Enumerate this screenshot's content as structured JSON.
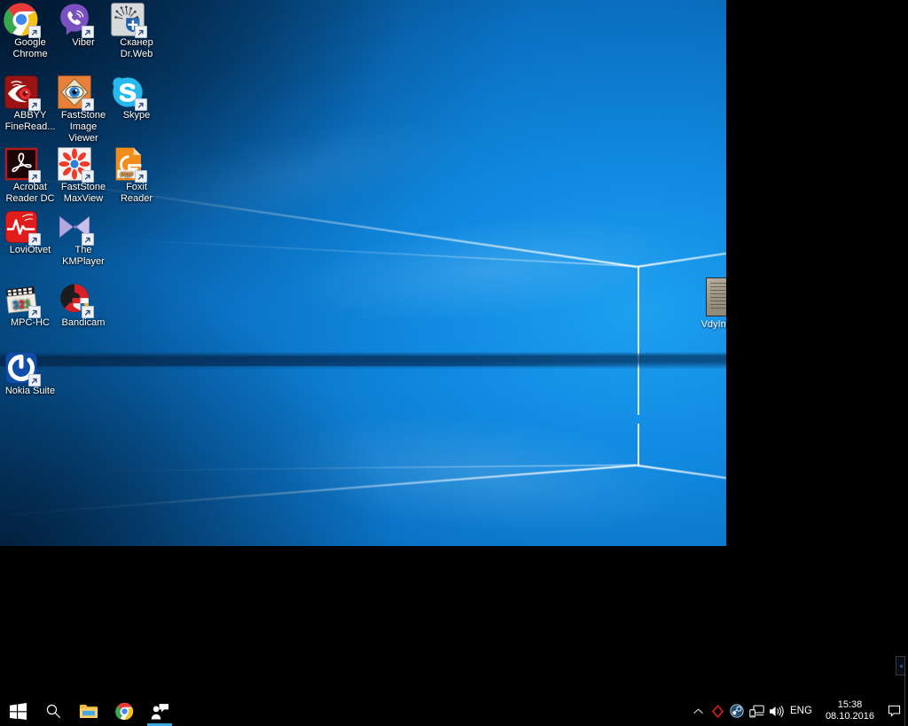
{
  "desktop": {
    "wallpaper_name": "windows-10-hero-wallpaper",
    "icons": [
      {
        "id": "google-chrome",
        "label": "Google Chrome",
        "icon": "chrome-icon",
        "col": 0,
        "row": 0
      },
      {
        "id": "viber",
        "label": "Viber",
        "icon": "viber-icon",
        "col": 1,
        "row": 0
      },
      {
        "id": "skaner-drweb",
        "label": "Сканер Dr.Web",
        "icon": "drweb-scanner-icon",
        "col": 2,
        "row": 0
      },
      {
        "id": "abbyy-finereader",
        "label": "ABBYY FineRead...",
        "icon": "abbyy-finereader-icon",
        "col": 0,
        "row": 1
      },
      {
        "id": "faststone-image-viewer",
        "label": "FastStone Image Viewer",
        "icon": "faststone-viewer-icon",
        "col": 1,
        "row": 1
      },
      {
        "id": "skype",
        "label": "Skype",
        "icon": "skype-icon",
        "col": 2,
        "row": 1
      },
      {
        "id": "acrobat-reader-dc",
        "label": "Acrobat Reader DC",
        "icon": "acrobat-reader-icon",
        "col": 0,
        "row": 2
      },
      {
        "id": "faststone-maxview",
        "label": "FastStone MaxView",
        "icon": "faststone-maxview-icon",
        "col": 1,
        "row": 2
      },
      {
        "id": "foxit-reader",
        "label": "Foxit Reader",
        "icon": "foxit-reader-icon",
        "col": 2,
        "row": 2
      },
      {
        "id": "loviotvet",
        "label": "LoviOtvet",
        "icon": "loviotvet-icon",
        "col": 0,
        "row": 3
      },
      {
        "id": "the-kmplayer",
        "label": "The KMPlayer",
        "icon": "kmplayer-icon",
        "col": 1,
        "row": 3
      },
      {
        "id": "mpc-hc",
        "label": "MPC-HC",
        "icon": "mpc-hc-icon",
        "col": 0,
        "row": 4
      },
      {
        "id": "bandicam",
        "label": "Bandicam",
        "icon": "bandicam-icon",
        "col": 1,
        "row": 4
      },
      {
        "id": "nokia-suite",
        "label": "Nokia Suite",
        "icon": "nokia-suite-icon",
        "col": 0,
        "row": 5
      }
    ],
    "edge_icon": {
      "label": "VdyIndG",
      "icon": "document-thumbnail-icon"
    }
  },
  "taskbar": {
    "start_label": "Start",
    "buttons": [
      {
        "id": "start",
        "icon": "windows-start-icon",
        "tooltip": "Start",
        "active": false
      },
      {
        "id": "search",
        "icon": "search-icon",
        "tooltip": "Search",
        "active": false
      },
      {
        "id": "file-explorer",
        "icon": "folder-icon",
        "tooltip": "File Explorer",
        "active": false
      },
      {
        "id": "chrome",
        "icon": "chrome-icon",
        "tooltip": "Google Chrome",
        "active": false
      },
      {
        "id": "people",
        "icon": "people-chat-icon",
        "tooltip": "People",
        "active": true
      }
    ],
    "tray": {
      "icons": [
        {
          "id": "show-hidden",
          "icon": "chevron-up-icon",
          "tooltip": "Show hidden icons"
        },
        {
          "id": "drweb",
          "icon": "drweb-diamond-icon",
          "tooltip": "Dr.Web"
        },
        {
          "id": "steam",
          "icon": "steam-icon",
          "tooltip": "Steam"
        },
        {
          "id": "network",
          "icon": "network-monitor-icon",
          "tooltip": "Network"
        },
        {
          "id": "volume",
          "icon": "speaker-volume-icon",
          "tooltip": "Volume"
        }
      ],
      "language": "ENG",
      "clock": {
        "time": "15:38",
        "date": "08.10.2016"
      },
      "action_center": {
        "icon": "action-center-icon",
        "tooltip": "Action Center"
      }
    }
  },
  "colors": {
    "taskbar_bg": "#000000",
    "accent": "#3aa7e0",
    "wallpaper_blue": "#108be2",
    "wallpaper_deep": "#03233f",
    "icon_label_text": "#ffffff"
  }
}
